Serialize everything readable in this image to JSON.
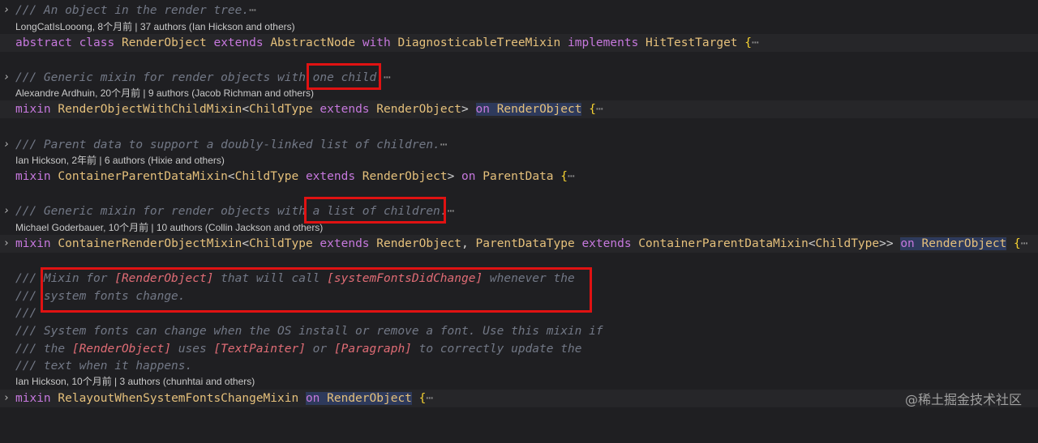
{
  "symbols": {
    "chevron": "›",
    "ellipsis": "⋯",
    "open_brace": "{",
    "lt": "<",
    "gt": ">",
    "gtgt": ">>",
    "comma": ", ",
    "comment_prefix": "///"
  },
  "keywords": {
    "abstract": "abstract",
    "class": "class",
    "extends": "extends",
    "with": "with",
    "implements": "implements",
    "mixin": "mixin",
    "on": "on"
  },
  "types": {
    "RenderObject": "RenderObject",
    "AbstractNode": "AbstractNode",
    "DiagnosticableTreeMixin": "DiagnosticableTreeMixin",
    "HitTestTarget": "HitTestTarget",
    "RenderObjectWithChildMixin": "RenderObjectWithChildMixin",
    "ChildType": "ChildType",
    "ContainerParentDataMixin": "ContainerParentDataMixin",
    "ParentData": "ParentData",
    "ContainerRenderObjectMixin": "ContainerRenderObjectMixin",
    "ParentDataType": "ParentDataType",
    "RelayoutWhenSystemFontsChangeMixin": "RelayoutWhenSystemFontsChangeMixin"
  },
  "blocks": [
    {
      "comment": "/// An object in the render tree.",
      "blame": "LongCatIsLooong, 8个月前 | 37 authors (Ian Hickson and others)"
    },
    {
      "comment": "/// Generic mixin for render objects with one child.",
      "blame": "Alexandre Ardhuin, 20个月前 | 9 authors (Jacob Richman and others)"
    },
    {
      "comment": "/// Parent data to support a doubly-linked list of children.",
      "blame": "Ian Hickson, 2年前 | 6 authors (Hixie and others)"
    },
    {
      "comment": "/// Generic mixin for render objects with a list of children.",
      "blame": "Michael Goderbauer, 10个月前 | 10 authors (Collin Jackson and others)"
    },
    {
      "blame": "Ian Hickson, 10个月前 | 3 authors (chunhtai and others)",
      "doc": {
        "l1_a": "/// Mixin for ",
        "l1_b": "[RenderObject]",
        "l1_c": " that will call ",
        "l1_d": "[systemFontsDidChange]",
        "l1_e": " whenever the",
        "l2": "/// system fonts change.",
        "l3": "///",
        "l4": "/// System fonts can change when the OS install or remove a font. Use this mixin if",
        "l5_a": "/// the ",
        "l5_b": "[RenderObject]",
        "l5_c": " uses ",
        "l5_d": "[TextPainter]",
        "l5_e": " or ",
        "l5_f": "[Paragraph]",
        "l5_g": " to correctly update the",
        "l6": "/// text when it happens."
      }
    }
  ],
  "watermark": "@稀土掘金技术社区"
}
